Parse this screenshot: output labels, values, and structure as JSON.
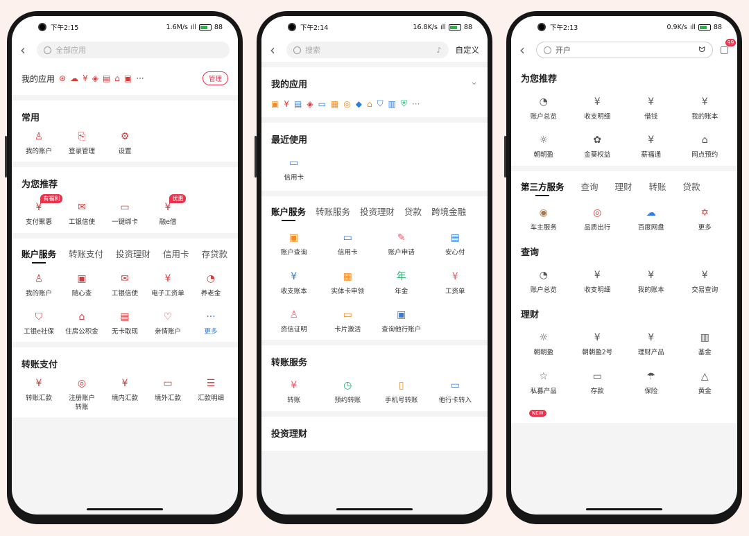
{
  "phone1": {
    "status": {
      "time": "下午2:15",
      "speed": "1.6M/s",
      "battery": "88"
    },
    "search_placeholder": "全部应用",
    "my_apps": {
      "title": "我的应用",
      "manage": "管理",
      "more": "···"
    },
    "common": {
      "title": "常用",
      "items": [
        {
          "label": "我的账户",
          "icon": "user-card-icon"
        },
        {
          "label": "登录管理",
          "icon": "login-icon"
        },
        {
          "label": "设置",
          "icon": "gear-icon"
        }
      ]
    },
    "recommend": {
      "title": "为您推荐",
      "items": [
        {
          "label": "支付聚惠",
          "icon": "pay-icon",
          "badge": "有福利"
        },
        {
          "label": "工银信使",
          "icon": "envelope-icon",
          "badge": ""
        },
        {
          "label": "一键绑卡",
          "icon": "card-icon",
          "badge": ""
        },
        {
          "label": "融e借",
          "icon": "loan-icon",
          "badge": "优惠"
        }
      ]
    },
    "tabs": [
      "账户服务",
      "转账支付",
      "投资理财",
      "信用卡",
      "存贷款"
    ],
    "account_items": [
      {
        "label": "我的账户",
        "icon": "user-icon"
      },
      {
        "label": "随心查",
        "icon": "search-card-icon"
      },
      {
        "label": "工银信使",
        "icon": "envelope-icon"
      },
      {
        "label": "电子工资单",
        "icon": "payslip-icon"
      },
      {
        "label": "养老金",
        "icon": "pension-icon"
      },
      {
        "label": "工银e社保",
        "icon": "shield-icon"
      },
      {
        "label": "住房公积金",
        "icon": "house-icon"
      },
      {
        "label": "无卡取现",
        "icon": "atm-icon"
      },
      {
        "label": "亲情账户",
        "icon": "heart-icon"
      },
      {
        "label": "更多",
        "icon": "more-icon"
      }
    ],
    "transfer": {
      "title": "转账支付",
      "items": [
        {
          "label": "转账汇款",
          "icon": "transfer-icon"
        },
        {
          "label": "注册账户转账",
          "icon": "register-transfer-icon"
        },
        {
          "label": "境内汇款",
          "icon": "domestic-icon"
        },
        {
          "label": "境外汇款",
          "icon": "foreign-icon"
        },
        {
          "label": "汇款明细",
          "icon": "detail-icon"
        }
      ]
    }
  },
  "phone2": {
    "status": {
      "time": "下午2:14",
      "speed": "16.8K/s",
      "battery": "88"
    },
    "search_placeholder": "搜索",
    "custom": "自定义",
    "my_apps": {
      "title": "我的应用",
      "more": "···"
    },
    "recent": {
      "title": "最近使用",
      "items": [
        {
          "label": "信用卡",
          "icon": "credit-card-icon"
        }
      ]
    },
    "tabs": [
      "账户服务",
      "转账服务",
      "投资理财",
      "贷款",
      "跨境金融"
    ],
    "account_items": [
      {
        "label": "账户查询",
        "icon": "account-query-icon"
      },
      {
        "label": "信用卡",
        "icon": "credit-card-icon"
      },
      {
        "label": "账户申请",
        "icon": "apply-icon"
      },
      {
        "label": "安心付",
        "icon": "safe-pay-icon"
      },
      {
        "label": "收支账本",
        "icon": "ledger-icon"
      },
      {
        "label": "实体卡申领",
        "icon": "card-apply-icon"
      },
      {
        "label": "年金",
        "icon": "annuity-icon"
      },
      {
        "label": "工资单",
        "icon": "payslip-icon"
      },
      {
        "label": "资信证明",
        "icon": "certificate-icon"
      },
      {
        "label": "卡片激活",
        "icon": "card-activate-icon"
      },
      {
        "label": "查询他行账户",
        "icon": "other-bank-icon"
      }
    ],
    "transfer": {
      "title": "转账服务",
      "items": [
        {
          "label": "转账",
          "icon": "transfer-icon"
        },
        {
          "label": "预约转账",
          "icon": "clock-icon"
        },
        {
          "label": "手机号转账",
          "icon": "phone-icon"
        },
        {
          "label": "他行卡转入",
          "icon": "card-in-icon"
        }
      ]
    },
    "next_title": "投资理财"
  },
  "phone3": {
    "status": {
      "time": "下午2:13",
      "speed": "0.9K/s",
      "battery": "88"
    },
    "search_placeholder": "开户",
    "msg_count": "99",
    "recommend": {
      "title": "为您推荐",
      "items": [
        {
          "label": "账户总览",
          "icon": "pie-icon"
        },
        {
          "label": "收支明细",
          "icon": "receipt-icon"
        },
        {
          "label": "借钱",
          "icon": "borrow-icon"
        },
        {
          "label": "我的账本",
          "icon": "book-icon"
        },
        {
          "label": "朝朝盈",
          "icon": "sunrise-icon"
        },
        {
          "label": "金葵权益",
          "icon": "flower-icon"
        },
        {
          "label": "薪福通",
          "icon": "salary-icon"
        },
        {
          "label": "网点预约",
          "icon": "branch-icon"
        }
      ]
    },
    "tabs": [
      "第三方服务",
      "查询",
      "理财",
      "转账",
      "贷款"
    ],
    "third_items": [
      {
        "label": "车主服务",
        "icon": "car-icon"
      },
      {
        "label": "品质出行",
        "icon": "travel-icon"
      },
      {
        "label": "百度网盘",
        "icon": "cloud-icon"
      },
      {
        "label": "更多",
        "icon": "star-icon"
      }
    ],
    "query": {
      "title": "查询",
      "items": [
        {
          "label": "账户总览",
          "icon": "pie-icon"
        },
        {
          "label": "收支明细",
          "icon": "receipt-icon"
        },
        {
          "label": "我的账本",
          "icon": "book-icon"
        },
        {
          "label": "交易查询",
          "icon": "search-money-icon"
        }
      ]
    },
    "wealth": {
      "title": "理财",
      "items": [
        {
          "label": "朝朝盈",
          "icon": "sunrise-icon"
        },
        {
          "label": "朝朝盈2号",
          "icon": "sunrise2-icon"
        },
        {
          "label": "理财产品",
          "icon": "product-icon"
        },
        {
          "label": "基金",
          "icon": "chart-icon"
        },
        {
          "label": "私募产品",
          "icon": "private-icon"
        },
        {
          "label": "存款",
          "icon": "deposit-icon"
        },
        {
          "label": "保险",
          "icon": "umbrella-icon"
        },
        {
          "label": "黄金",
          "icon": "gold-icon"
        }
      ]
    },
    "new_badge": "NEW"
  }
}
